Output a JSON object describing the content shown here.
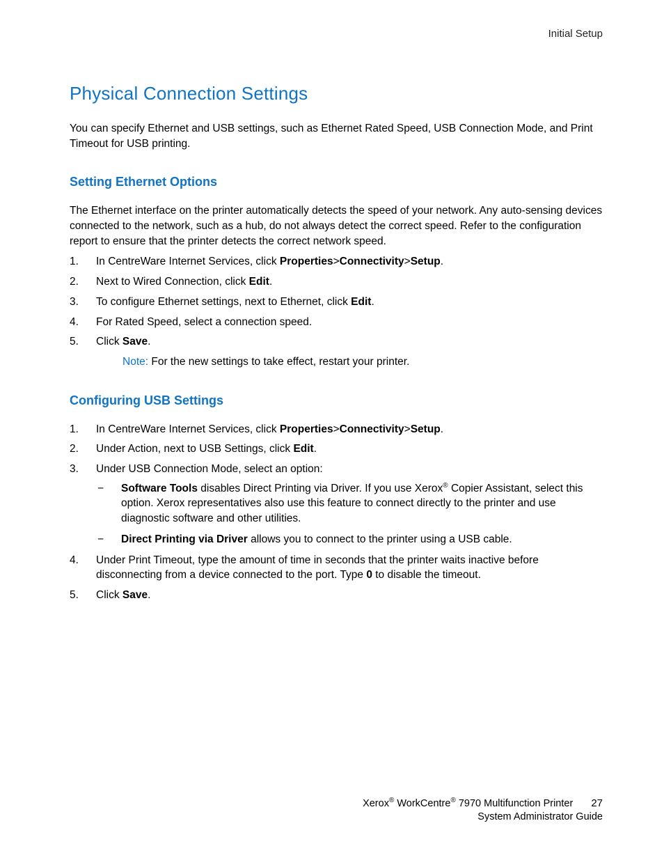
{
  "header": {
    "breadcrumb": "Initial Setup"
  },
  "title": "Physical Connection Settings",
  "intro": "You can specify Ethernet and USB settings, such as Ethernet Rated Speed, USB Connection Mode, and Print Timeout for USB printing.",
  "section1": {
    "heading": "Setting Ethernet Options",
    "para": "The Ethernet interface on the printer automatically detects the speed of your network. Any auto-sensing devices connected to the network, such as a hub, do not always detect the correct speed. Refer to the configuration report to ensure that the printer detects the correct network speed.",
    "steps": {
      "s1a": "In CentreWare Internet Services, click ",
      "s1b": "Properties",
      "s1c": ">",
      "s1d": "Connectivity",
      "s1e": ">",
      "s1f": "Setup",
      "s1g": ".",
      "s2a": "Next to Wired Connection, click ",
      "s2b": "Edit",
      "s2c": ".",
      "s3a": "To configure Ethernet settings, next to Ethernet, click ",
      "s3b": "Edit",
      "s3c": ".",
      "s4": "For Rated Speed, select a connection speed.",
      "s5a": "Click ",
      "s5b": "Save",
      "s5c": "."
    },
    "note_label": "Note:",
    "note_text": " For the new settings to take effect, restart your printer."
  },
  "section2": {
    "heading": "Configuring USB Settings",
    "steps": {
      "s1a": "In CentreWare Internet Services, click ",
      "s1b": "Properties",
      "s1c": ">",
      "s1d": "Connectivity",
      "s1e": ">",
      "s1f": "Setup",
      "s1g": ".",
      "s2a": "Under Action, next to USB Settings, click ",
      "s2b": "Edit",
      "s2c": ".",
      "s3": "Under USB Connection Mode, select an option:",
      "s3_sub1a": "Software Tools",
      "s3_sub1b": " disables Direct Printing via Driver. If you use Xerox",
      "s3_sub1c": " Copier Assistant, select this option. Xerox representatives also use this feature to connect directly to the printer and use diagnostic software and other utilities.",
      "s3_sub2a": "Direct Printing via Driver",
      "s3_sub2b": " allows you to connect to the printer using a USB cable.",
      "s4a": "Under Print Timeout, type the amount of time in seconds that the printer waits inactive before disconnecting from a device connected to the port. Type ",
      "s4b": "0",
      "s4c": " to disable the timeout.",
      "s5a": "Click ",
      "s5b": "Save",
      "s5c": "."
    }
  },
  "footer": {
    "brand1": "Xerox",
    "brand2": " WorkCentre",
    "model": " 7970 Multifunction Printer",
    "line2": "System Administrator Guide",
    "page": "27",
    "reg": "®"
  }
}
